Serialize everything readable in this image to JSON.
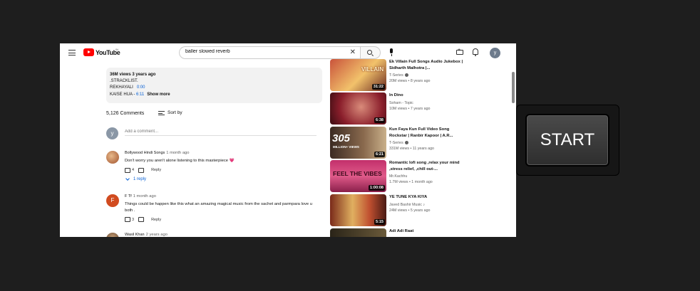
{
  "header": {
    "logo_text": "YouTube",
    "logo_sup": "IN",
    "search_value": "baller slowed reverb",
    "avatar_letter": "y"
  },
  "description": {
    "views_time": "36M views  3 years ago",
    "line1": ".STRACKLIST.",
    "line2_text": "REKHAYALI",
    "line2_ts": "0:00",
    "line3_text": "KAISE HUA -",
    "line3_ts": "6:11",
    "show_more": "Show more"
  },
  "comments_header": {
    "count": "5,126 Comments",
    "sort_label": "Sort by"
  },
  "add_comment": {
    "avatar_letter": "y",
    "placeholder": "Add a comment..."
  },
  "comments": [
    {
      "author": "Bollywood Hindi Songs",
      "time": "1 month ago",
      "text": "Don't worry you aren't alone listening to this masterpiece 💗",
      "likes": "4",
      "reply_label": "Reply",
      "replies": "1 reply"
    },
    {
      "avatar_letter": "F",
      "author": "F Tf",
      "time": "1 month ago",
      "text": "Things could be happen like this what an amazing magical music from the sachet and parmpara love u both .",
      "likes": "3",
      "reply_label": "Reply"
    },
    {
      "author": "Wasil Khan",
      "time": "2 years ago"
    }
  ],
  "related": [
    {
      "title": "Ek Villain Full Songs Audio Jukebox | Sidharth Malhotra |...",
      "channel": "T-Series",
      "meta": "20M views  •  8 years ago",
      "duration": "31:22",
      "thumb_text": "VILLAIN"
    },
    {
      "title": "In Dino",
      "channel": "Soham - Topic",
      "meta": "10M views  •  7 years ago",
      "duration": "6:38"
    },
    {
      "title": "Kun Faya Kun Full Video Song Rockstar | Ranbir Kapoor | A.R...",
      "channel": "T-Series",
      "meta": "331M views  •  11 years ago",
      "duration": "6:21",
      "thumb_text": "305",
      "thumb_sub": "MILLION+ VIEWS"
    },
    {
      "title": "Romantic lofi song ,relax your mind ,stress relief, ,chill out-...",
      "channel": "Mr.Kachhu",
      "meta": "1.7M views  •  1 month ago",
      "duration": "1:00:08",
      "thumb_text": "FEEL THE VIBES"
    },
    {
      "title": "YE TUNE KYA KIYA",
      "channel": "Javed Bashir Music ♪",
      "meta": "24M views  •  5 years ago",
      "duration": "5:15"
    },
    {
      "title": "Adi Adi Raat",
      "channel": "",
      "meta": "",
      "duration": ""
    }
  ],
  "overlay": {
    "start_label": "START"
  },
  "colors": {
    "background": "#1e1e1e",
    "youtube_red": "#ff0000",
    "link_blue": "#065fd4"
  }
}
